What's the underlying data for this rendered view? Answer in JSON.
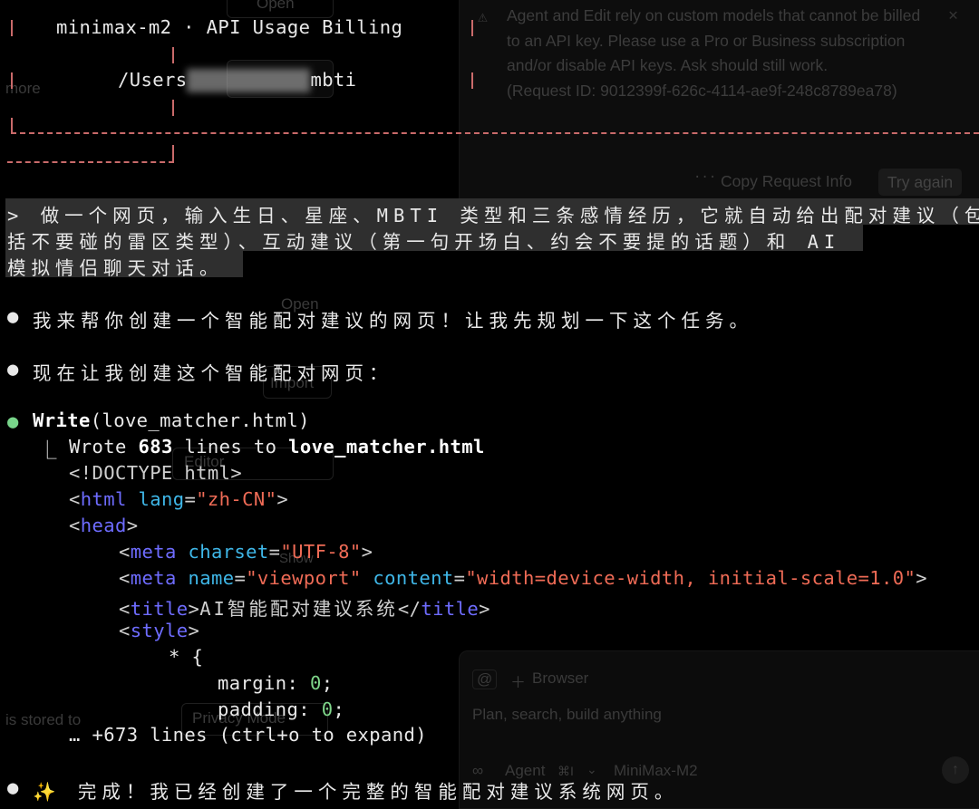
{
  "ghost": {
    "more": "more",
    "open1": "Open",
    "open2": "Open",
    "import": "Import",
    "editor": "Editor",
    "show": "Show",
    "stored": "is stored to",
    "privacy": "Privacy Mode",
    "notification": {
      "message": "Agent and Edit rely on custom models that cannot be billed to an API key. Please use a Pro or Business subscription and/or disable API keys. Ask should still work.",
      "request_id": "(Request ID: 9012399f-626c-4114-ae9f-248c8789ea78)",
      "copy_label": "Copy Request Info",
      "retry_label": "Try again"
    },
    "composer": {
      "at": "@",
      "browser": "Browser",
      "placeholder": "Plan, search, build anything",
      "agent": "Agent",
      "shortcut": "⌘I",
      "model": "MiniMax-M2"
    }
  },
  "terminal": {
    "header_model": "minimax-m2 · API Usage Billing",
    "path_prefix": "/Users",
    "path_suffix": "mbti",
    "prompt_line1": "> 做一个网页，输入生日、星座、MBTI 类型和三条感情经历，它就自动给出配对建议（包",
    "prompt_line2": "括不要碰的雷区类型）、互动建议（第一句开场白、约会不要提的话题）和 AI",
    "prompt_line3": "模拟情侣聊天对话。",
    "reply1": "我来帮你创建一个智能配对建议的网页！让我先规划一下这个任务。",
    "reply2": "现在让我创建这个智能配对网页：",
    "tool_name": "Write",
    "tool_arg": "(love_matcher.html)",
    "wrote_prefix": "Wrote",
    "wrote_count": "683",
    "wrote_mid": "lines to",
    "wrote_file": "love_matcher.html",
    "code": {
      "doctype": "<!DOCTYPE html>",
      "html_tag": "html",
      "lang_attr": "lang",
      "lang_val": "\"zh-CN\"",
      "head_tag": "head",
      "meta1_tag": "meta",
      "charset_attr": "charset",
      "charset_val": "\"UTF-8\"",
      "meta2_tag": "meta",
      "name_attr": "name",
      "name_val": "\"viewport\"",
      "content_attr": "content",
      "content_val": "\"width=device-width, initial-scale=1.0\"",
      "title_tag": "title",
      "title_text": "AI智能配对建议系统",
      "style_tag": "style",
      "selector": "* {",
      "margin_prop": "margin",
      "margin_val": "0",
      "padding_prop": "padding",
      "padding_val": "0"
    },
    "expand": "… +673 lines (ctrl+o to expand)",
    "done": "✨ 完成！我已经创建了一个完整的智能配对建议系统网页。"
  }
}
